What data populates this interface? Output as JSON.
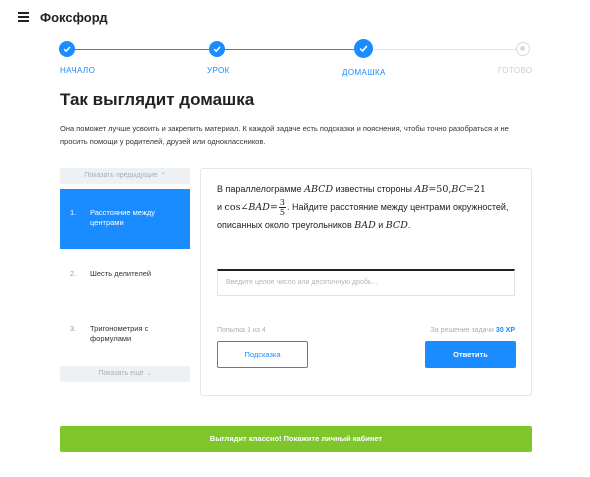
{
  "header": {
    "logo": "Фоксфорд"
  },
  "stepper": {
    "steps": [
      {
        "label": "НАЧАЛО",
        "state": "done"
      },
      {
        "label": "УРОК",
        "state": "done"
      },
      {
        "label": "ДОМАШКА",
        "state": "current"
      },
      {
        "label": "ГОТОВО",
        "state": "todo"
      }
    ]
  },
  "page": {
    "title": "Так выглядит домашка",
    "description": "Она поможет лучше усвоить и закрепить материал. К каждой задаче есть подсказки и пояснения, чтобы точно разобраться и не просить помощи у родителей, друзей или одноклассников."
  },
  "sidebar": {
    "prev_label": "Показать предыдущие",
    "more_label": "Показать ещё",
    "items": [
      {
        "num": "1.",
        "label": "Расстояние между центрами",
        "active": true
      },
      {
        "num": "2.",
        "label": "Шесть делителей",
        "active": false
      },
      {
        "num": "3.",
        "label": "Тригонометрия с формулами",
        "active": false
      }
    ]
  },
  "task": {
    "text_1": "В параллелограмме",
    "abcd": "ABCD",
    "text_2": "известны стороны",
    "ab": "AB",
    "eq": "=",
    "v50": "50",
    "comma": ",",
    "bc": "BC",
    "v21": "21",
    "and": "и",
    "cos": "cos",
    "angle_bad": "∠BAD",
    "frac_num": "3",
    "frac_den": "5",
    "text_3": ". Найдите расстояние между центрами окружностей, описанных около треугольников",
    "bad": "BAD",
    "and2": "и",
    "bcd": "BCD",
    "dot": ".",
    "input_placeholder": "Введите целое число или десятичную дробь...",
    "attempt": "Попытка 1 из 4",
    "reward_text": "За решение задачи",
    "reward_xp": "30 XP",
    "hint_label": "Подсказка",
    "submit_label": "Ответить"
  },
  "cta": {
    "label": "Выглядит классно! Покажите личный кабинет"
  },
  "colors": {
    "accent": "#1a8cff",
    "cta": "#7ec62c",
    "inactive": "#dfe3e8"
  }
}
